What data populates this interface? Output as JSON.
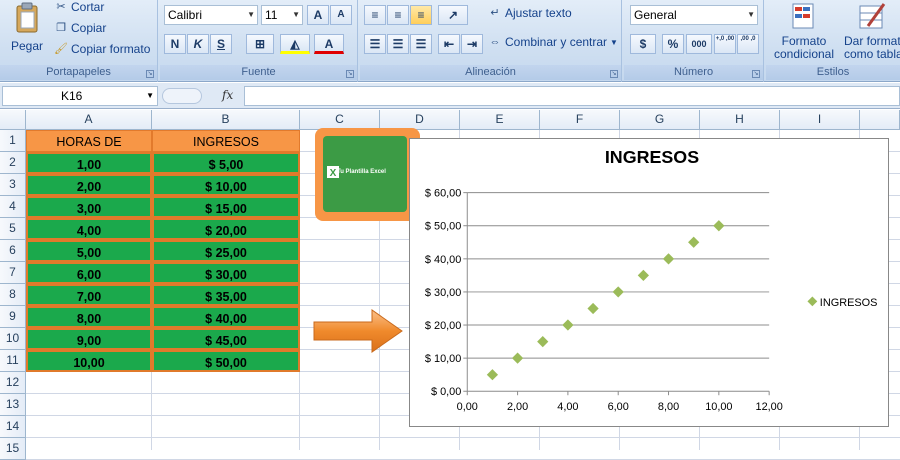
{
  "ribbon": {
    "clipboard": {
      "paste": "Pegar",
      "cut": "Cortar",
      "copy": "Copiar",
      "format_painter": "Copiar formato",
      "label": "Portapapeles"
    },
    "font": {
      "name": "Calibri",
      "size": "11",
      "bold": "N",
      "italic": "K",
      "underline": "S",
      "grow": "A",
      "shrink": "A",
      "label": "Fuente"
    },
    "alignment": {
      "wrap": "Ajustar texto",
      "merge": "Combinar y centrar",
      "label": "Alineación"
    },
    "number": {
      "format": "General",
      "currency": "$",
      "percent": "%",
      "thousands": "000",
      "inc_decimal": "+,0 ,00",
      "dec_decimal": ",00 ,0",
      "label": "Número"
    },
    "styles": {
      "conditional_line1": "Formato",
      "conditional_line2": "condicional",
      "table_line1": "Dar format",
      "table_line2": "como tabla",
      "label": "Estilos"
    }
  },
  "formula_bar": {
    "cell_ref": "K16",
    "fx": "fx",
    "value": ""
  },
  "columns": [
    "A",
    "B",
    "C",
    "D",
    "E",
    "F",
    "G",
    "H",
    "I"
  ],
  "rows": [
    "1",
    "2",
    "3",
    "4",
    "5",
    "6",
    "7",
    "8",
    "9",
    "10",
    "11",
    "12",
    "13",
    "14",
    "15"
  ],
  "table": {
    "headers": [
      "HORAS DE TRABAJO",
      "INGRESOS"
    ],
    "rows": [
      [
        "1,00",
        "$ 5,00"
      ],
      [
        "2,00",
        "$ 10,00"
      ],
      [
        "3,00",
        "$ 15,00"
      ],
      [
        "4,00",
        "$ 20,00"
      ],
      [
        "5,00",
        "$ 25,00"
      ],
      [
        "6,00",
        "$ 30,00"
      ],
      [
        "7,00",
        "$ 35,00"
      ],
      [
        "8,00",
        "$ 40,00"
      ],
      [
        "9,00",
        "$ 45,00"
      ],
      [
        "10,00",
        "$ 50,00"
      ]
    ]
  },
  "logo": {
    "text": "Tu Plantilla Excel"
  },
  "colors": {
    "header_orange": "#f79646",
    "data_green": "#1ba94c",
    "marker": "#9bbb59",
    "ribbon": "#cfdff1"
  },
  "chart_data": {
    "type": "scatter",
    "title": "INGRESOS",
    "series": [
      {
        "name": "INGRESOS",
        "x": [
          1,
          2,
          3,
          4,
          5,
          6,
          7,
          8,
          9,
          10
        ],
        "y": [
          5,
          10,
          15,
          20,
          25,
          30,
          35,
          40,
          45,
          50
        ]
      }
    ],
    "xlim": [
      0,
      12
    ],
    "ylim": [
      0,
      60
    ],
    "x_ticks": [
      "0,00",
      "2,00",
      "4,00",
      "6,00",
      "8,00",
      "10,00",
      "12,00"
    ],
    "y_ticks": [
      "$ 0,00",
      "$ 10,00",
      "$ 20,00",
      "$ 30,00",
      "$ 40,00",
      "$ 50,00",
      "$ 60,00"
    ],
    "grid": "horizontal",
    "legend": "right",
    "xlabel": "",
    "ylabel": ""
  }
}
